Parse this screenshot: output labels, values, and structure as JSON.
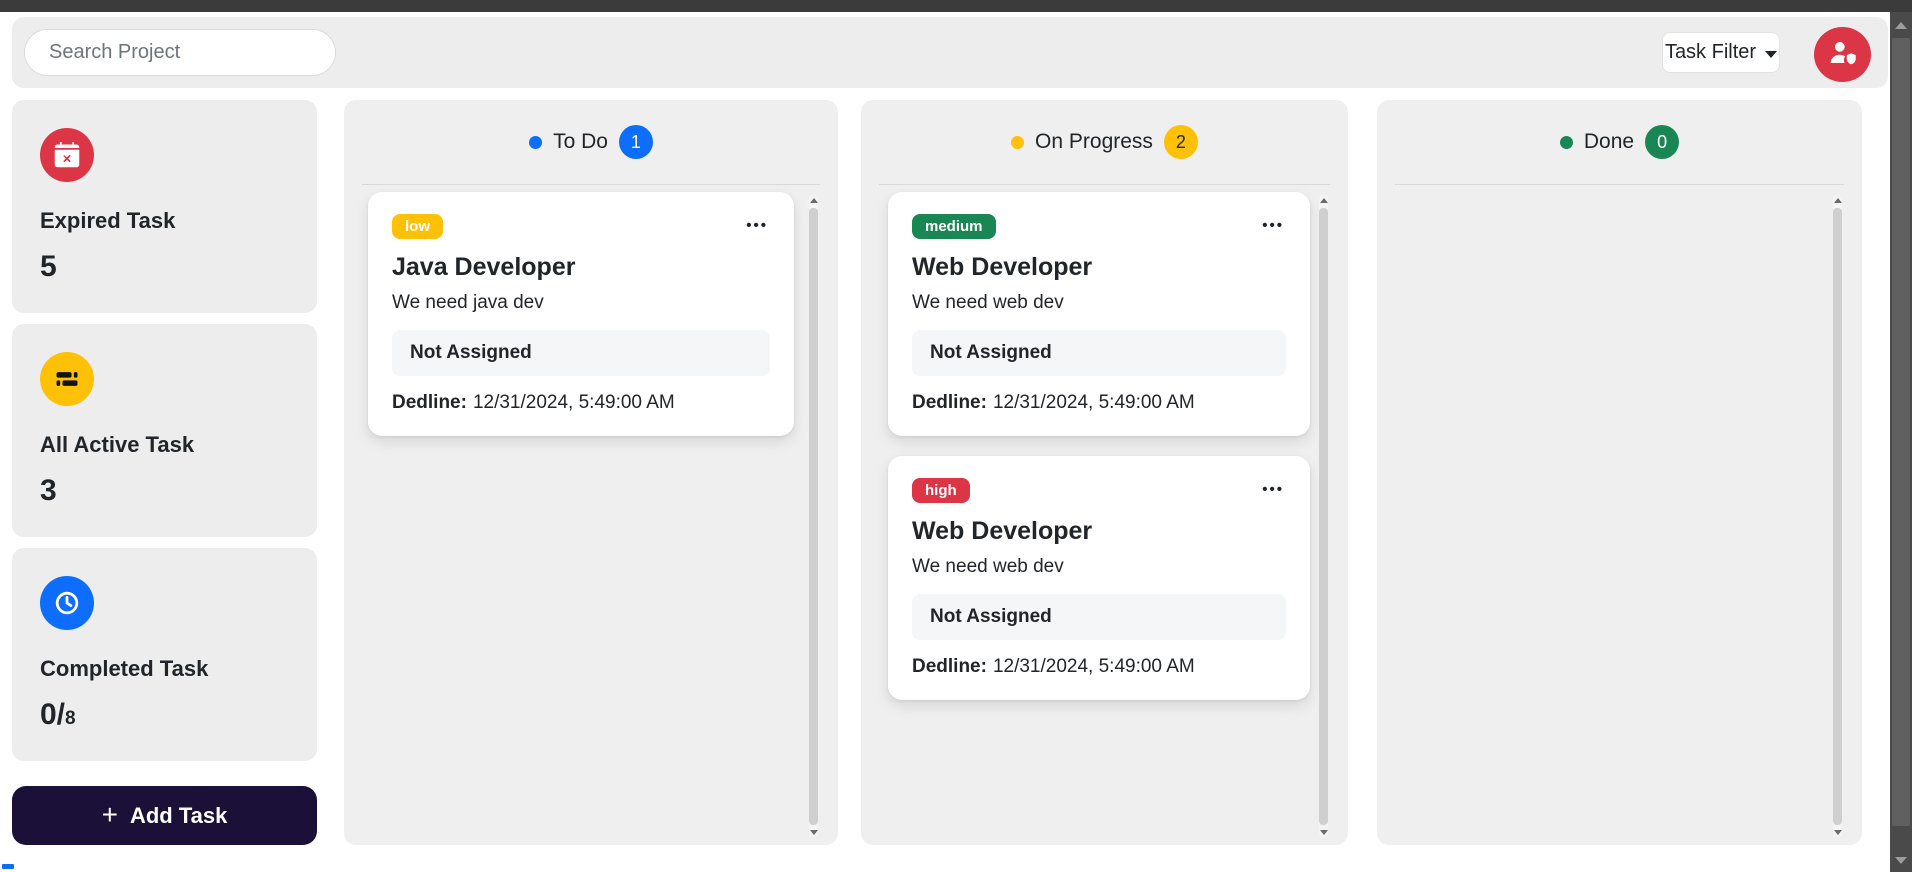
{
  "toolbar": {
    "search_placeholder": "Search Project",
    "task_filter_label": "Task Filter",
    "user_button_icon": "person-shield-icon",
    "user_button_color": "#dc3545"
  },
  "sidebar": {
    "stats": [
      {
        "label": "Expired Task",
        "value": "5",
        "icon": "calendar-x-icon",
        "icon_bg": "#dc3545"
      },
      {
        "label": "All Active Task",
        "value": "3",
        "icon": "list-task-icon",
        "icon_bg": "#ffc107"
      },
      {
        "label": "Completed Task",
        "value_main": "0/",
        "value_sub": "8",
        "icon": "clock-icon",
        "icon_bg": "#0d6efd"
      }
    ],
    "add_task": {
      "plus": "+",
      "label": "Add Task"
    }
  },
  "board": {
    "columns": [
      {
        "title": "To Do",
        "count": "1",
        "accent": "#0d6efd",
        "cards": [
          {
            "priority": "low",
            "priority_color": "#ffc107",
            "menu": "•••",
            "title": "Java Developer",
            "description": "We need java dev",
            "assignee": "Not Assigned",
            "deadline_label": "Dedline:",
            "deadline": "12/31/2024, 5:49:00 AM"
          }
        ]
      },
      {
        "title": "On Progress",
        "count": "2",
        "accent": "#ffc107",
        "cards": [
          {
            "priority": "medium",
            "priority_color": "#198754",
            "menu": "•••",
            "title": "Web Developer",
            "description": "We need web dev",
            "assignee": "Not Assigned",
            "deadline_label": "Dedline:",
            "deadline": "12/31/2024, 5:49:00 AM"
          },
          {
            "priority": "high",
            "priority_color": "#dc3545",
            "menu": "•••",
            "title": "Web Developer",
            "description": "We need web dev",
            "assignee": "Not Assigned",
            "deadline_label": "Dedline:",
            "deadline": "12/31/2024, 5:49:00 AM"
          }
        ]
      },
      {
        "title": "Done",
        "count": "0",
        "accent": "#198754",
        "cards": []
      }
    ]
  }
}
